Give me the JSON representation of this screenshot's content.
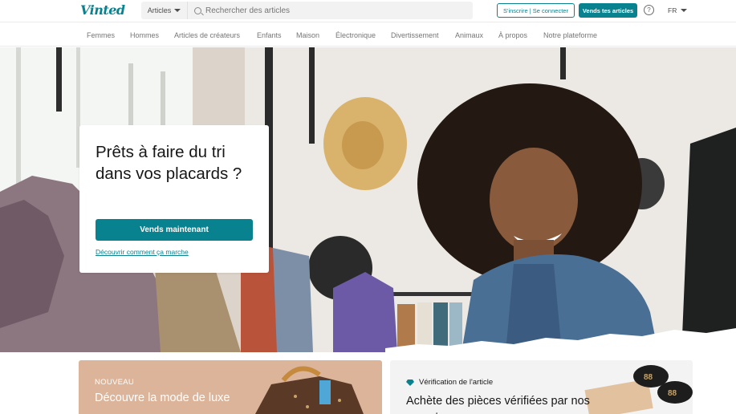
{
  "header": {
    "logo": "Vinted",
    "search_category": "Articles",
    "search_placeholder": "Rechercher des articles",
    "auth_label": "S'inscrire | Se connecter",
    "sell_label": "Vends tes articles",
    "help_symbol": "?",
    "language": "FR",
    "icons": [
      "search-icon",
      "chevron-down-icon",
      "help-icon"
    ]
  },
  "nav": {
    "items": [
      "Femmes",
      "Hommes",
      "Articles de créateurs",
      "Enfants",
      "Maison",
      "Électronique",
      "Divertissement",
      "Animaux",
      "À propos",
      "Notre plateforme"
    ]
  },
  "hero": {
    "title": "Prêts à faire du tri dans vos placards ?",
    "button": "Vends maintenant",
    "link": "Découvrir comment ça marche"
  },
  "promos": {
    "left": {
      "badge": "NOUVEAU",
      "title": "Découvre la mode de luxe"
    },
    "right": {
      "badge": "Vérification de l'article",
      "title": "Achète des pièces vérifiées par nos experts"
    }
  },
  "colors": {
    "accent": "#09828f",
    "promo_left_bg": "#dcb49a",
    "promo_right_bg": "#f3f3f3"
  }
}
